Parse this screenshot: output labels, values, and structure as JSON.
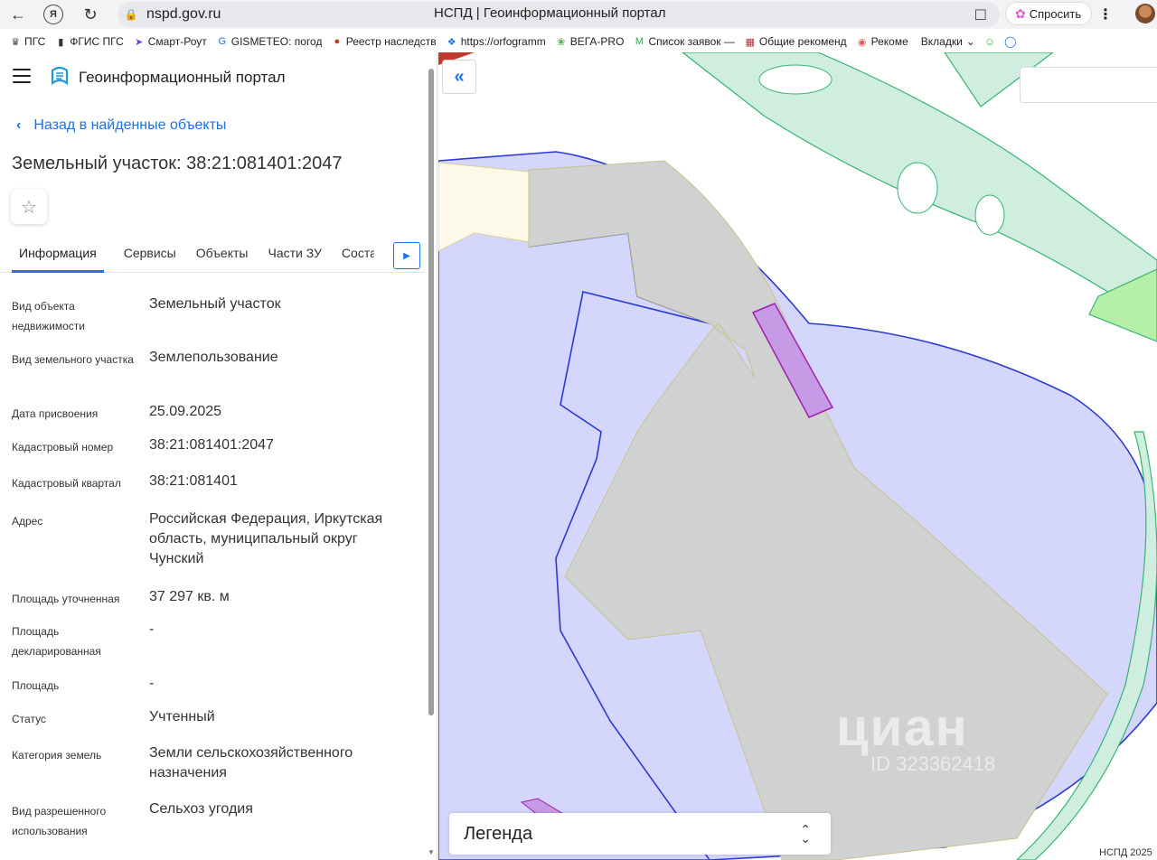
{
  "browser": {
    "url": "nspd.gov.ru",
    "page_title": "НСПД | Геоинформационный портал",
    "ask_label": "Спросить",
    "bookmarks": [
      {
        "icon": "eagle-icon",
        "label": "ПГС"
      },
      {
        "icon": "shield-icon",
        "label": "ФГИС ПГС"
      },
      {
        "icon": "route-icon",
        "label": "Смарт-Роут"
      },
      {
        "icon": "gismeteo-icon",
        "label": "GISMETEO: погод"
      },
      {
        "icon": "registry-icon",
        "label": "Реестр наследств"
      },
      {
        "icon": "orfogrammka-icon",
        "label": "https://orfogramm"
      },
      {
        "icon": "leaf-icon",
        "label": "ВЕГА-PRO"
      },
      {
        "icon": "gmail-icon",
        "label": "Список заявок —"
      },
      {
        "icon": "calendar-icon",
        "label": "Общие рекоменд"
      },
      {
        "icon": "target-icon",
        "label": "Рекоме"
      }
    ],
    "bookmarks_folder": "Вкладки"
  },
  "portal": {
    "name": "Геоинформационный портал",
    "back_link": "Назад в найденные объекты",
    "object_title": "Земельный участок: 38:21:081401:2047",
    "tabs": [
      "Информация",
      "Сервисы",
      "Объекты",
      "Части ЗУ",
      "Состав"
    ]
  },
  "properties": [
    {
      "label": "Вид объекта недвижимости",
      "value": "Земельный участок"
    },
    {
      "label": "Вид земельного участка",
      "value": "Землепользование"
    },
    {
      "label": "Дата присвоения",
      "value": "25.09.2025"
    },
    {
      "label": "Кадастровый номер",
      "value": "38:21:081401:2047"
    },
    {
      "label": "Кадастровый квартал",
      "value": "38:21:081401"
    },
    {
      "label": "Адрес",
      "value": "Российская Федерация, Иркутская область, муниципальный округ Чунский"
    },
    {
      "label": "Площадь уточненная",
      "value": "37 297 кв. м"
    },
    {
      "label": "Площадь декларированная",
      "value": "-"
    },
    {
      "label": "Площадь",
      "value": "-"
    },
    {
      "label": "Статус",
      "value": "Учтенный"
    },
    {
      "label": "Категория земель",
      "value": "Земли сельскохозяйственного назначения"
    },
    {
      "label": "Вид разрешенного использования",
      "value": "Сельхоз угодия"
    }
  ],
  "map": {
    "legend_label": "Легенда",
    "watermark": "циан",
    "watermark_id": "ID 323362418",
    "copyright": "НСПД 2025",
    "colors": {
      "zone_fill": "#d4d6fb",
      "zone_border": "#2b3ad6",
      "parcel_fill": "#d0d2d2",
      "water_green": "#cfeee0",
      "green_border": "#35b572",
      "highlight": "#c79ae6",
      "highlight_border": "#a020b0"
    }
  }
}
